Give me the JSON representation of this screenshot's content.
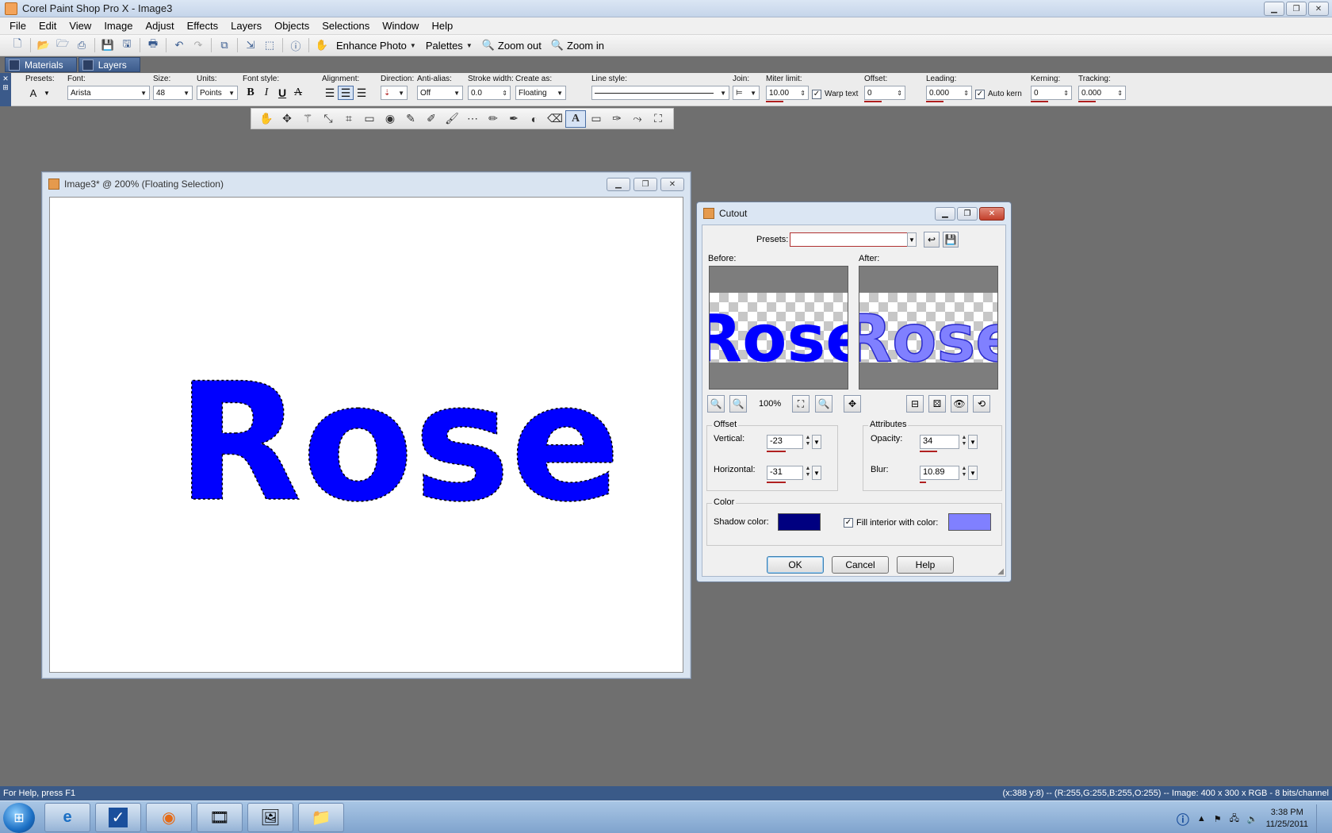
{
  "app": {
    "title": "Corel Paint Shop Pro X - Image3"
  },
  "menu": [
    "File",
    "Edit",
    "View",
    "Image",
    "Adjust",
    "Effects",
    "Layers",
    "Objects",
    "Selections",
    "Window",
    "Help"
  ],
  "toolbar": {
    "enhance_photo": "Enhance Photo",
    "palettes": "Palettes",
    "zoom_out": "Zoom out",
    "zoom_in": "Zoom in"
  },
  "palette_tabs": [
    "Materials",
    "Layers"
  ],
  "text_options": {
    "presets_label": "Presets:",
    "font_label": "Font:",
    "font_value": "Arista",
    "size_label": "Size:",
    "size_value": "48",
    "units_label": "Units:",
    "units_value": "Points",
    "font_style_label": "Font style:",
    "alignment_label": "Alignment:",
    "direction_label": "Direction:",
    "antialias_label": "Anti-alias:",
    "antialias_value": "Off",
    "stroke_label": "Stroke width:",
    "stroke_value": "0.0",
    "create_as_label": "Create as:",
    "create_as_value": "Floating",
    "line_style_label": "Line style:",
    "join_label": "Join:",
    "miter_label": "Miter limit:",
    "miter_value": "10.00",
    "warp_text": "Warp text",
    "offset_label": "Offset:",
    "offset_value": "0",
    "leading_label": "Leading:",
    "leading_value": "0.000",
    "auto_kern": "Auto kern",
    "kerning_label": "Kerning:",
    "kerning_value": "0",
    "tracking_label": "Tracking:",
    "tracking_value": "0.000"
  },
  "document": {
    "title": "Image3* @ 200% (Floating Selection)",
    "text": "Rose",
    "text_color": "#0000ff"
  },
  "dialog": {
    "title": "Cutout",
    "presets_label": "Presets:",
    "presets_value": "",
    "before_label": "Before:",
    "after_label": "After:",
    "preview_text": "Rose",
    "zoom": "100%",
    "offset_group": "Offset",
    "vertical_label": "Vertical:",
    "vertical_value": "-23",
    "horizontal_label": "Horizontal:",
    "horizontal_value": "-31",
    "attributes_group": "Attributes",
    "opacity_label": "Opacity:",
    "opacity_value": "34",
    "blur_label": "Blur:",
    "blur_value": "10.89",
    "color_group": "Color",
    "shadow_color_label": "Shadow color:",
    "shadow_color": "#000080",
    "fill_interior_label": "Fill interior with color:",
    "fill_color": "#8080ff",
    "ok": "OK",
    "cancel": "Cancel",
    "help": "Help"
  },
  "status": {
    "left": "For Help, press F1",
    "right": "(x:388 y:8) -- (R:255,G:255,B:255,O:255) -- Image:  400 x 300 x RGB - 8 bits/channel"
  },
  "taskbar": {
    "time": "3:38 PM",
    "date": "11/25/2011"
  }
}
